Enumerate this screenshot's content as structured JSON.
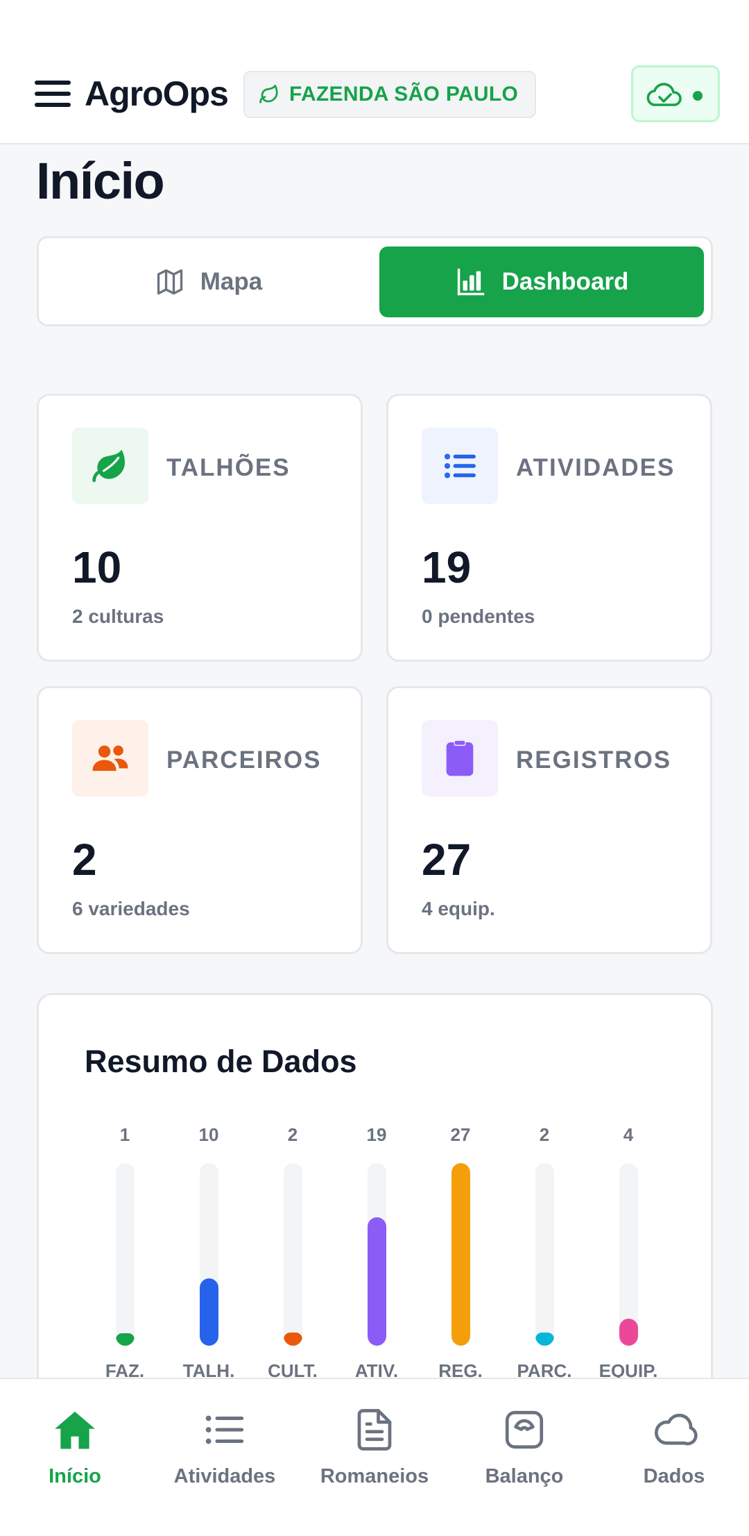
{
  "header": {
    "app_name": "AgroOps",
    "farm_name": "FAZENDA SÃO PAULO",
    "icons": {
      "menu": "hamburger-icon",
      "farm": "leaf-icon",
      "sync": "cloud-check-icon"
    },
    "sync_status_color": "#16a34a"
  },
  "page": {
    "title": "Início"
  },
  "view_toggle": {
    "map_label": "Mapa",
    "dashboard_label": "Dashboard",
    "selected": "Dashboard"
  },
  "stats": [
    {
      "label": "TALHÕES",
      "value": "10",
      "sub": "2 culturas",
      "icon": "leaf-icon",
      "color": "#16a34a",
      "bg": "#ecf8f0"
    },
    {
      "label": "ATIVIDADES",
      "value": "19",
      "sub": "0 pendentes",
      "icon": "list-icon",
      "color": "#2563eb",
      "bg": "#eef3fe"
    },
    {
      "label": "PARCEIROS",
      "value": "2",
      "sub": "6 variedades",
      "icon": "users-icon",
      "color": "#ea580c",
      "bg": "#fdf1ea"
    },
    {
      "label": "REGISTROS",
      "value": "27",
      "sub": "4 equip.",
      "icon": "clipboard-icon",
      "color": "#8b5cf6",
      "bg": "#f4f0fe"
    }
  ],
  "summary": {
    "title": "Resumo de Dados"
  },
  "chart_data": {
    "type": "bar",
    "title": "Resumo de Dados",
    "categories": [
      "FAZ.",
      "TALH.",
      "CULT.",
      "ATIV.",
      "REG.",
      "PARC.",
      "EQUIP."
    ],
    "values": [
      1,
      10,
      2,
      19,
      27,
      2,
      4
    ],
    "value_labels": [
      "1",
      "10",
      "2",
      "19",
      "27",
      "2",
      "4"
    ],
    "colors": [
      "#16a34a",
      "#2563eb",
      "#ea580c",
      "#8b5cf6",
      "#f59e0b",
      "#06b6d4",
      "#ec4899"
    ],
    "ylim": [
      0,
      27
    ],
    "grid": false
  },
  "bottom_nav": {
    "items": [
      {
        "label": "Início",
        "icon": "home-icon",
        "active": true
      },
      {
        "label": "Atividades",
        "icon": "list-icon",
        "active": false
      },
      {
        "label": "Romaneios",
        "icon": "document-icon",
        "active": false
      },
      {
        "label": "Balanço",
        "icon": "scale-icon",
        "active": false
      },
      {
        "label": "Dados",
        "icon": "cloud-icon",
        "active": false
      }
    ],
    "active_color": "#16a34a"
  }
}
